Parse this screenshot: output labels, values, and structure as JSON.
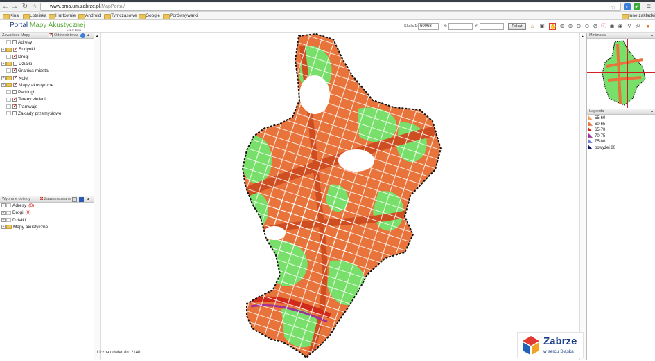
{
  "browser": {
    "url_host": "www.pma.um.zabrze.pl",
    "url_path": "/MapPortal/",
    "bookmarks": [
      "Kina",
      "Lotniska",
      "Hurtownie",
      "Android",
      "Tymczasowe",
      "Google",
      "Porównywarki"
    ],
    "other_bookmarks": "Inne zakładki"
  },
  "header": {
    "title_part1": "Portal",
    "title_part2": "Mapy Akustycznej",
    "version": "v. 2.0 Beta",
    "scale_label": "Skala 1:",
    "scale_value": "60068",
    "x_label": "X:",
    "y_label": "Y:",
    "show_button": "Pokaż"
  },
  "layers_panel": {
    "title": "Zawartość Mapy",
    "refresh_label": "Odśwież teraz",
    "items": [
      {
        "label": "Adresy",
        "checked": false,
        "expandable": false,
        "folder": false
      },
      {
        "label": "Budynki",
        "checked": true,
        "expandable": true,
        "folder": true
      },
      {
        "label": "Drogi",
        "checked": true,
        "expandable": false,
        "folder": false
      },
      {
        "label": "Działki",
        "checked": false,
        "expandable": true,
        "folder": true
      },
      {
        "label": "Granica miasta",
        "checked": true,
        "expandable": false,
        "folder": false
      },
      {
        "label": "Kolej",
        "checked": true,
        "expandable": true,
        "folder": true
      },
      {
        "label": "Mapy akustyczne",
        "checked": true,
        "expandable": true,
        "folder": true
      },
      {
        "label": "Parkingi",
        "checked": false,
        "expandable": false,
        "folder": false
      },
      {
        "label": "Tereny zieleni",
        "checked": true,
        "expandable": false,
        "folder": false
      },
      {
        "label": "Tramwaje",
        "checked": true,
        "expandable": false,
        "folder": false
      },
      {
        "label": "Zakłady przemysłowe",
        "checked": false,
        "expandable": false,
        "folder": false
      }
    ]
  },
  "selected_panel": {
    "title": "Wybrane obiekty",
    "advanced_label": "Zaawansowane",
    "items": [
      {
        "label": "Adresy",
        "count": "(0)",
        "folder": false
      },
      {
        "label": "Drogi",
        "count": "(0)",
        "folder": false
      },
      {
        "label": "Działki",
        "count": "",
        "folder": false
      },
      {
        "label": "Mapy akustyczne",
        "count": "",
        "folder": true
      }
    ]
  },
  "map": {
    "visits": "Liczba odwiedzin: 2140",
    "colors": {
      "noise": "#e8743b",
      "noise_dark": "#cf4e21",
      "green": "#78e06a",
      "road": "#ffffff",
      "boundary": "#111111"
    }
  },
  "minimap": {
    "title": "Minimapa"
  },
  "legend": {
    "title": "Legenda",
    "items": [
      {
        "label": "55-60",
        "color": "#f0a060"
      },
      {
        "label": "60-65",
        "color": "#e8743b"
      },
      {
        "label": "65-70",
        "color": "#d02a1a"
      },
      {
        "label": "70-75",
        "color": "#a0309a"
      },
      {
        "label": "75-80",
        "color": "#7080e0"
      },
      {
        "label": "powyżej 80",
        "color": "#101070"
      }
    ]
  },
  "brand": {
    "name": "Zabrze",
    "slogan": "w sercu Śląska"
  }
}
